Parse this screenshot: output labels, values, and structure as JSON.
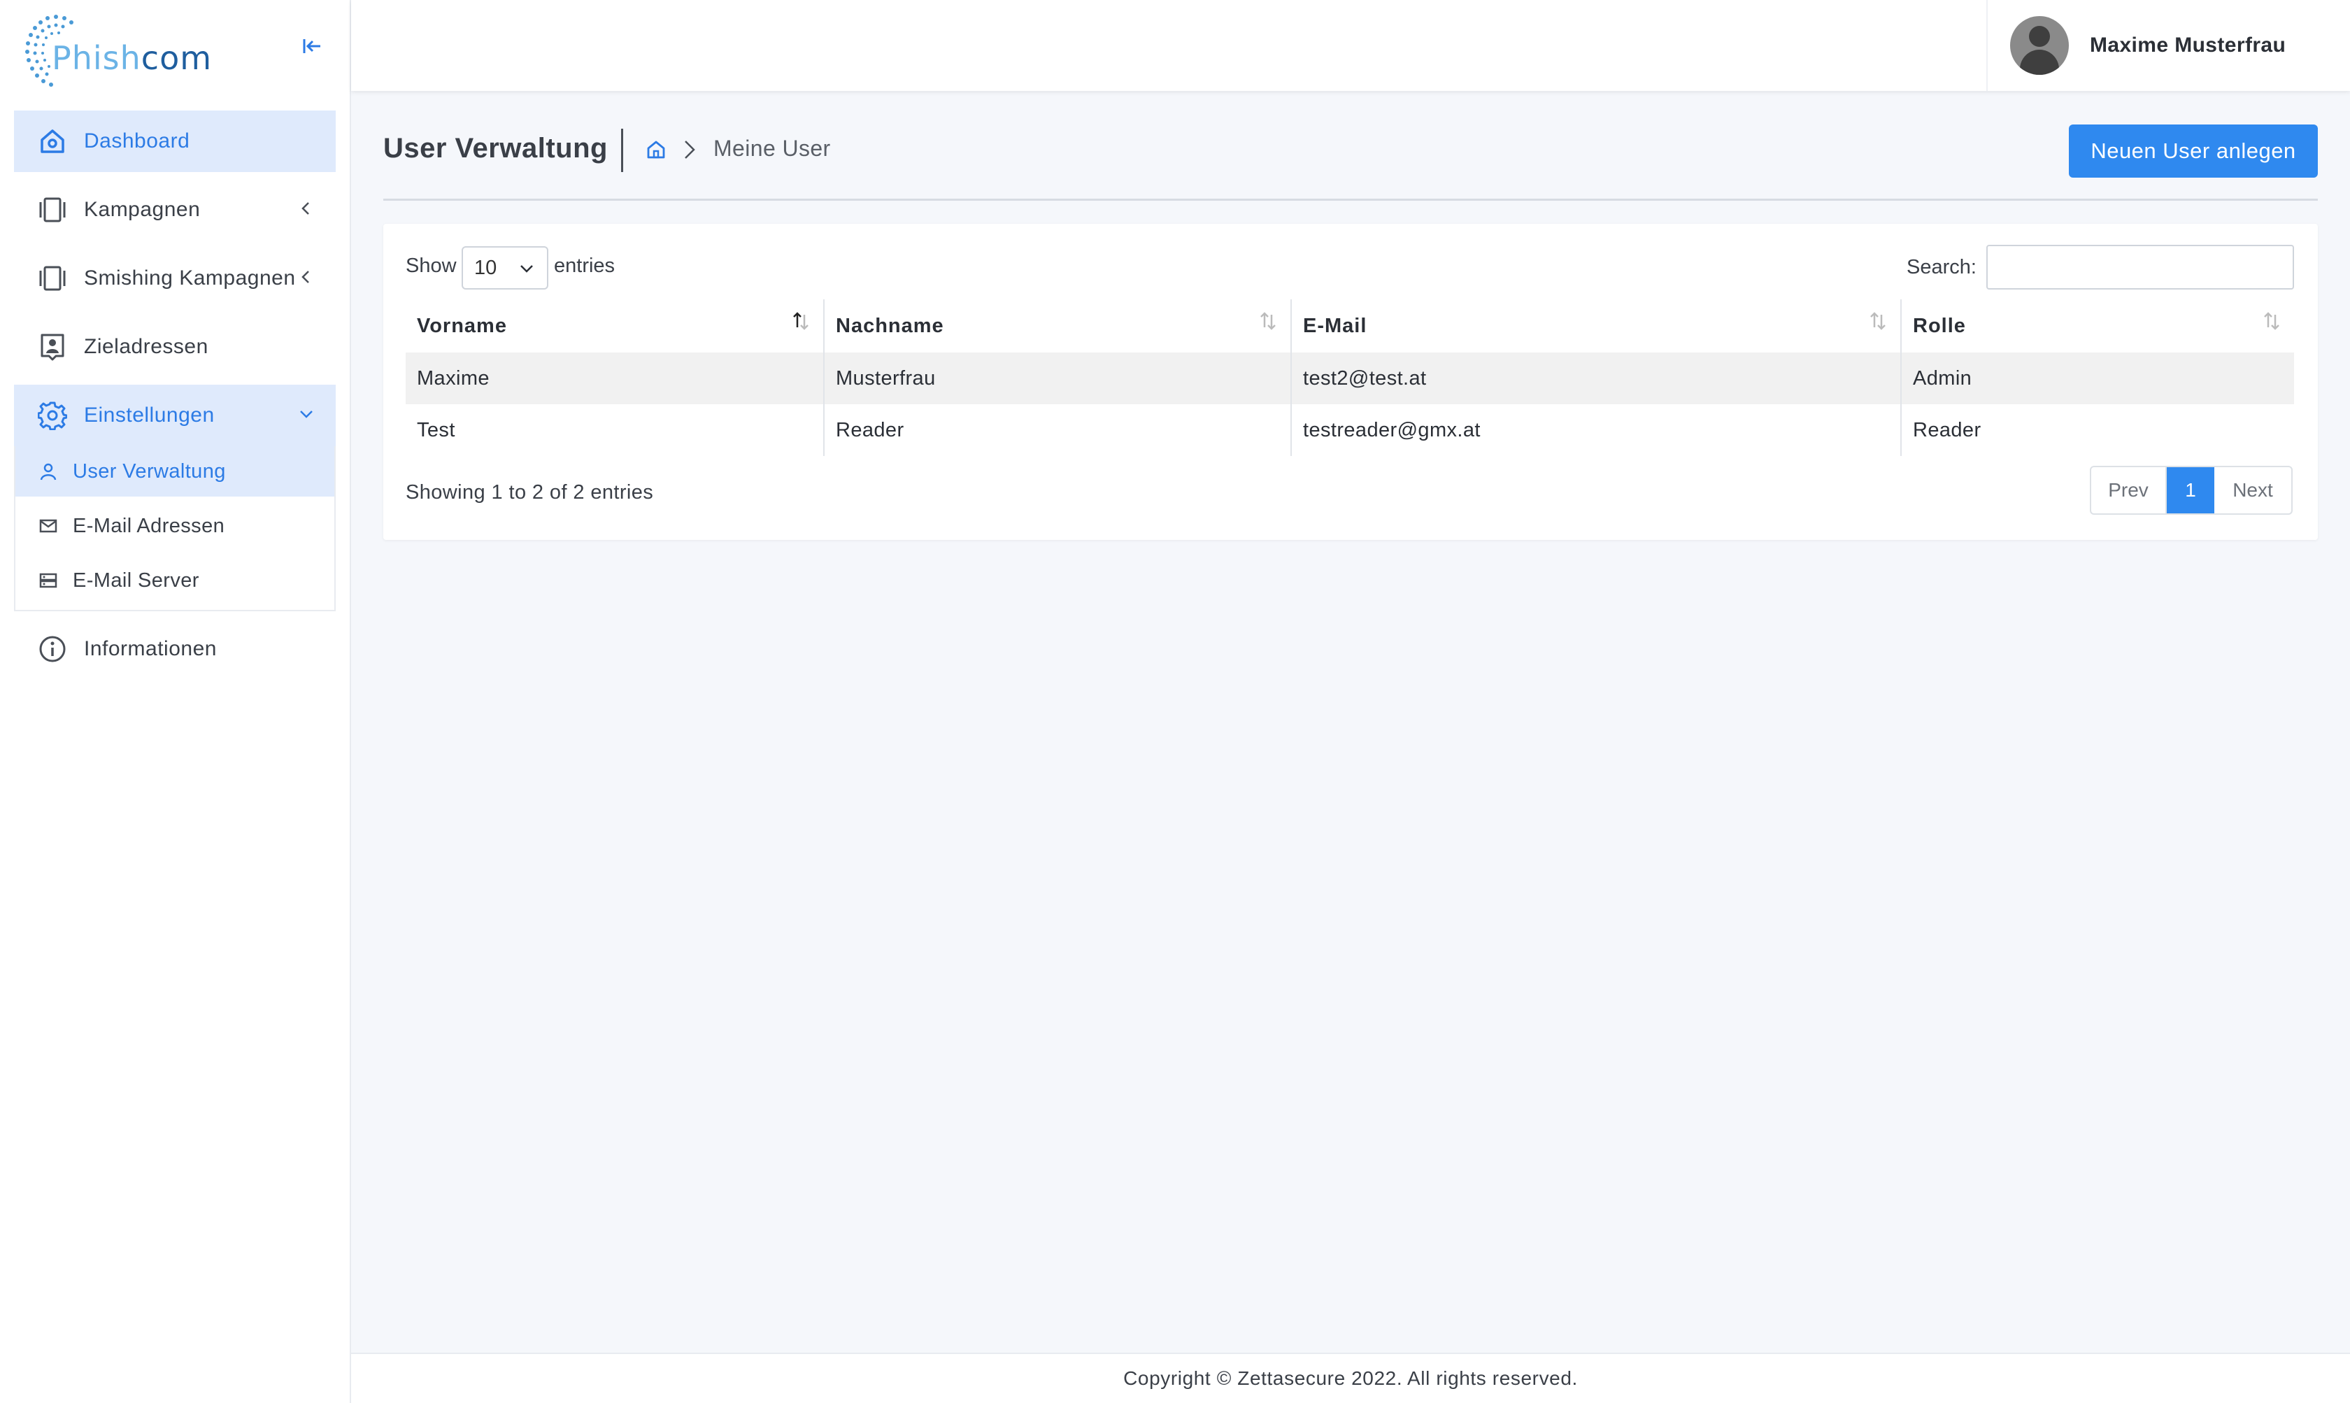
{
  "app": {
    "logo_text_a": "Phish",
    "logo_text_b": "com",
    "brand_colors": {
      "light": "#6bb3e6",
      "dark": "#1f5e9e"
    }
  },
  "sidebar": {
    "items": [
      {
        "label": "Dashboard",
        "icon": "home-icon",
        "active": true
      },
      {
        "label": "Kampagnen",
        "icon": "campaigns-icon",
        "chevron": "left"
      },
      {
        "label": "Smishing Kampagnen",
        "icon": "campaigns-icon",
        "chevron": "left"
      },
      {
        "label": "Zieladressen",
        "icon": "address-card-icon"
      },
      {
        "label": "Einstellungen",
        "icon": "gear-icon",
        "chevron": "down",
        "active": true
      },
      {
        "label": "Informationen",
        "icon": "info-icon"
      }
    ],
    "settings_sub": [
      {
        "label": "User Verwaltung",
        "icon": "user-icon",
        "active": true
      },
      {
        "label": "E-Mail Adressen",
        "icon": "mail-icon"
      },
      {
        "label": "E-Mail Server",
        "icon": "server-icon"
      }
    ]
  },
  "header": {
    "user_name": "Maxime Musterfrau"
  },
  "page": {
    "title": "User Verwaltung",
    "breadcrumb_current": "Meine User",
    "new_button": "Neuen User anlegen"
  },
  "table": {
    "length_label": "Show",
    "length_value": "10",
    "length_after": "entries",
    "search_label": "Search:",
    "search_value": "",
    "columns": [
      "Vorname",
      "Nachname",
      "E-Mail",
      "Rolle"
    ],
    "rows": [
      [
        "Maxime",
        "Musterfrau",
        "test2@test.at",
        "Admin"
      ],
      [
        "Test",
        "Reader",
        "testreader@gmx.at",
        "Reader"
      ]
    ],
    "info": "Showing 1 to 2 of 2 entries",
    "pager": {
      "prev": "Prev",
      "page": "1",
      "next": "Next"
    }
  },
  "footer": {
    "text": "Copyright © Zettasecure 2022. All rights reserved."
  },
  "colors": {
    "accent": "#2f89ef",
    "active_bg": "#dfeafc",
    "active_text": "#2c7be5"
  }
}
